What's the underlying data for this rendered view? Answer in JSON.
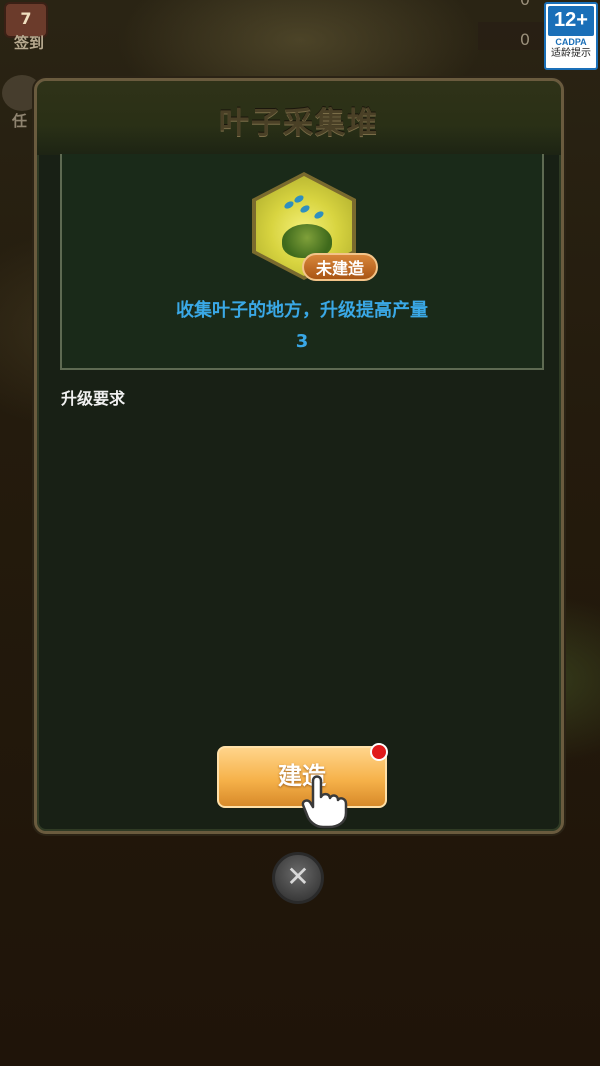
{
  "background": {
    "checkin_icon_text": "7",
    "checkin_label": "签到",
    "task_label": "任",
    "score_top": "0",
    "score": "0"
  },
  "age_rating": {
    "number": "12+",
    "org": "CADPA",
    "tip": "适龄提示"
  },
  "dialog": {
    "title": "叶子采集堆",
    "building": {
      "icon": "leaf-bush-icon",
      "status": "未建造",
      "description": "收集叶子的地方，升级提高产量",
      "value": "3"
    },
    "requirements_label": "升级要求",
    "build_button_label": "建造",
    "notification_dot": true
  },
  "close_button_icon": "close-icon",
  "colors": {
    "accent_blue": "#3aa8e6",
    "button_orange": "#f6b24a",
    "status_tag": "#c56c24",
    "dialog_bg": "#182015"
  }
}
